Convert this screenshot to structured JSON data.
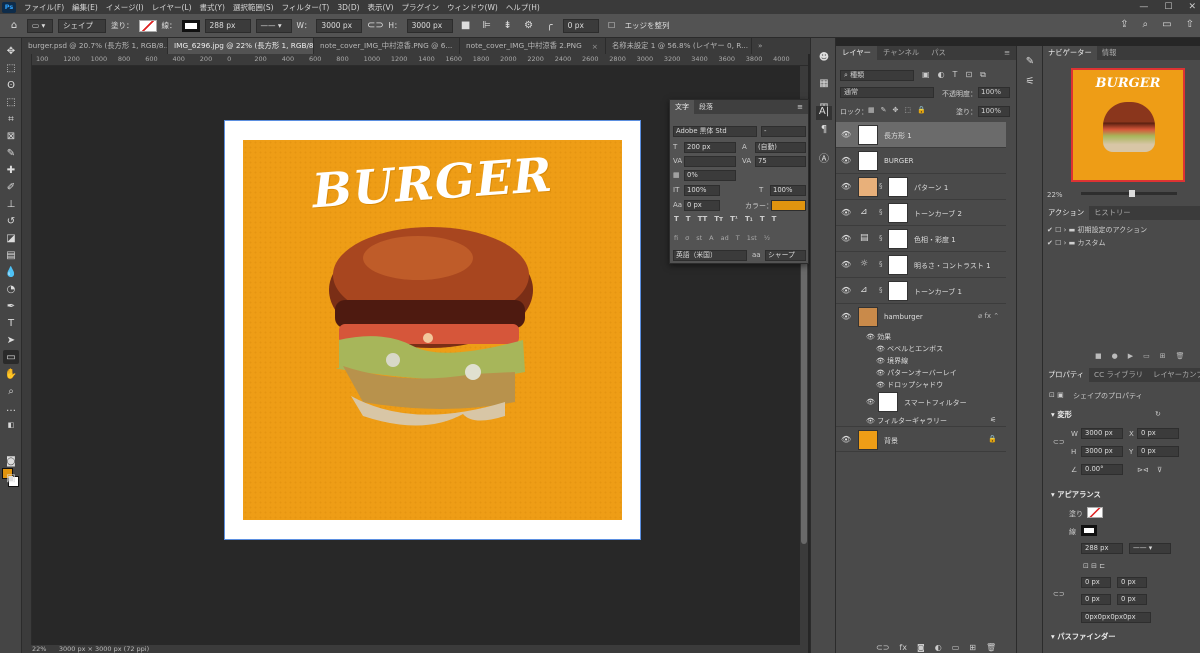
{
  "app": {
    "logo": "Ps"
  },
  "menu": [
    "ファイル(F)",
    "編集(E)",
    "イメージ(I)",
    "レイヤー(L)",
    "書式(Y)",
    "選択範囲(S)",
    "フィルター(T)",
    "3D(D)",
    "表示(V)",
    "プラグイン",
    "ウィンドウ(W)",
    "ヘルプ(H)"
  ],
  "window_controls": [
    "—",
    "☐",
    "✕"
  ],
  "options": {
    "shape_mode": "シェイプ",
    "fill_label": "塗り：",
    "stroke_label": "線：",
    "stroke_width": "288 px",
    "w_label": "W：",
    "w_value": "3000 px",
    "h_label": "H：",
    "h_value": "3000 px",
    "radius": "0 px",
    "align_edges": "エッジを整列"
  },
  "tabs": [
    {
      "label": "burger.psd @ 20.7% (長方形 1, RGB/8...",
      "active": false
    },
    {
      "label": "IMG_6296.jpg @ 22% (長方形 1, RGB/8*) *",
      "active": true
    },
    {
      "label": "note_cover_IMG_中村涼香.PNG @ 6...",
      "active": false
    },
    {
      "label": "note_cover_IMG_中村涼香 2.PNG",
      "active": false
    },
    {
      "label": "名称未設定 1 @ 56.8% (レイヤー 0, R...",
      "active": false
    }
  ],
  "ruler_ticks": [
    "100",
    "1200",
    "1000",
    "800",
    "600",
    "400",
    "200",
    "0",
    "200",
    "400",
    "600",
    "800",
    "1000",
    "1200",
    "1400",
    "1600",
    "1800",
    "2000",
    "2200",
    "2400",
    "2600",
    "2800",
    "3000",
    "3200",
    "3400",
    "3600",
    "3800",
    "4000"
  ],
  "artwork": {
    "title": "BURGER",
    "bg_color": "#ee9d16"
  },
  "status": {
    "zoom": "22%",
    "size": "3000 px × 3000 px (72 ppi)"
  },
  "character_panel": {
    "tabs": [
      "文字",
      "段落"
    ],
    "font_family": "Adobe 黒体 Std",
    "font_style": "-",
    "font_size": "200 px",
    "leading": "(自動)",
    "kerning": "",
    "tracking": "75",
    "tsume": "0%",
    "vscale": "100%",
    "hscale": "100%",
    "baseline": "0 px",
    "color_label": "カラー：",
    "color": "#e0940f",
    "style_buttons": [
      "T",
      "T",
      "TT",
      "Tт",
      "T¹",
      "T₁",
      "T",
      "T"
    ],
    "ot_buttons": [
      "fi",
      "σ",
      "st",
      "A",
      "ad",
      "T",
      "1st",
      "½"
    ],
    "language": "英語（米国）",
    "antialias": "シャープ"
  },
  "layers_panel": {
    "tabs": [
      "レイヤー",
      "チャンネル",
      "パス"
    ],
    "filter_kind": "種類",
    "blend_mode": "通常",
    "opacity_label": "不透明度：",
    "opacity": "100%",
    "lock_label": "ロック：",
    "fill_label": "塗り：",
    "fill": "100%",
    "layers": [
      {
        "name": "長方形 1",
        "selected": true
      },
      {
        "name": "BURGER",
        "selected": false
      },
      {
        "name": "パターン 1",
        "selected": false
      },
      {
        "name": "トーンカーブ 2",
        "selected": false
      },
      {
        "name": "色相・彩度 1",
        "selected": false
      },
      {
        "name": "明るさ・コントラスト 1",
        "selected": false
      },
      {
        "name": "トーンカーブ 1",
        "selected": false
      },
      {
        "name": "hamburger",
        "selected": false
      },
      {
        "name": "背景",
        "selected": false
      }
    ],
    "effects_label": "効果",
    "effects": [
      "ベベルとエンボス",
      "境界線",
      "パターンオーバーレイ",
      "ドロップシャドウ"
    ],
    "smart_filter": "スマートフィルター",
    "filter_gallery": "フィルターギャラリー"
  },
  "navigator": {
    "tabs": [
      "ナビゲーター",
      "情報"
    ],
    "zoom": "22%",
    "thumb_title": "BURGER"
  },
  "actions": {
    "tabs": [
      "アクション",
      "ヒストリー"
    ],
    "items": [
      "初期設定のアクション",
      "カスタム"
    ]
  },
  "properties": {
    "tabs": [
      "プロパティ",
      "CC ライブラリ",
      "レイヤーカンプ"
    ],
    "title": "シェイプのプロパティ",
    "transform_label": "変形",
    "w_label": "W",
    "w": "3000 px",
    "x_label": "X",
    "x": "0 px",
    "h_label": "H",
    "h": "3000 px",
    "y_label": "Y",
    "y": "0 px",
    "angle": "0.00°",
    "appearance_label": "アピアランス",
    "fill_label": "塗り",
    "stroke_label": "線",
    "stroke_width": "288 px",
    "corner_tl": "0 px",
    "corner_tr": "0 px",
    "corner_bl": "0 px",
    "corner_br": "0 px",
    "corners_all": "0px0px0px0px",
    "pathfinder_label": "パスファインダー"
  }
}
